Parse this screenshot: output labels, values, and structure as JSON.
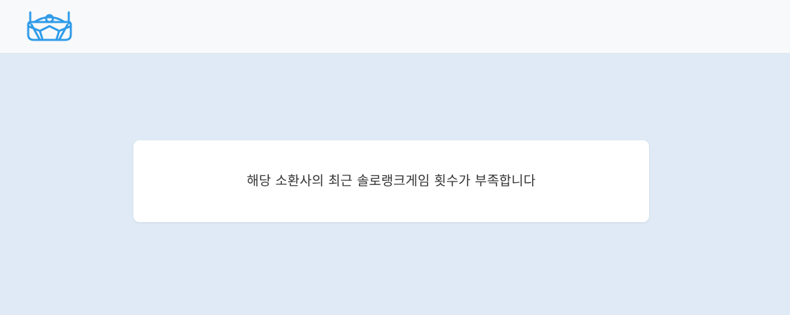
{
  "header": {
    "logo_icon": "robot-mask-icon",
    "logo_color": "#2f9be9"
  },
  "main": {
    "message": "해당 소환사의 최근 솔로랭크게임 횟수가 부족합니다"
  }
}
